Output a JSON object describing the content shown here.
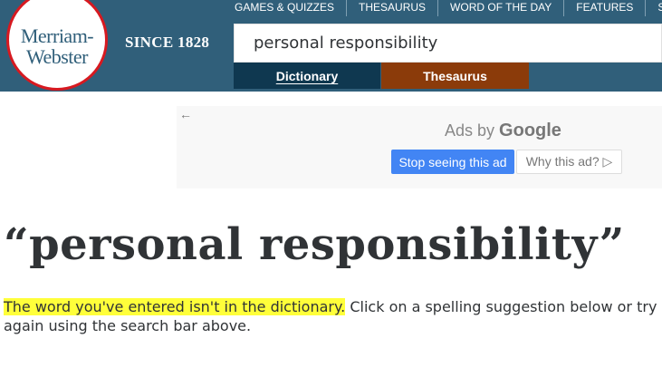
{
  "logo": {
    "line1": "Merriam-",
    "line2": "Webster"
  },
  "tagline": "SINCE 1828",
  "top_nav": [
    "GAMES & QUIZZES",
    "THESAURUS",
    "WORD OF THE DAY",
    "FEATURES",
    "S"
  ],
  "search": {
    "value": "personal responsibility"
  },
  "tabs": {
    "dictionary": "Dictionary",
    "thesaurus": "Thesaurus"
  },
  "ad": {
    "back_arrow": "←",
    "label_prefix": "Ads by",
    "label_brand": "Google",
    "stop_button": "Stop seeing this ad",
    "why_button": "Why this ad? ▷"
  },
  "headword": "“personal responsibility”",
  "message": {
    "highlighted": "The word you've entered isn't in the dictionary.",
    "rest": " Click on a spelling suggestion below or try again using the search bar above."
  },
  "colors": {
    "header": "#305f7a",
    "tab_dictionary": "#0f3850",
    "tab_thesaurus": "#8b3b0a",
    "highlight": "#ffff3a",
    "ad_button": "#4285f4"
  }
}
